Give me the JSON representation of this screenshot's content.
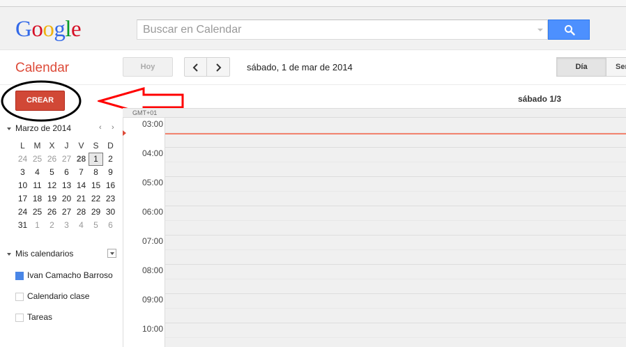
{
  "colors": {
    "accent_red": "#dd4b39",
    "create_button": "#d14836",
    "search_blue": "#4d90fe",
    "calendar_blue": "#4986e7",
    "annotation_red": "#ff0000"
  },
  "header": {
    "logo_letters": [
      "G",
      "o",
      "o",
      "g",
      "l",
      "e"
    ],
    "logo_colors": [
      "#3369e8",
      "#d50f25",
      "#eeb211",
      "#3369e8",
      "#009925",
      "#d50f25"
    ],
    "search_placeholder": "Buscar en Calendar",
    "search_icon": "search-icon"
  },
  "toolbar": {
    "app_title": "Calendar",
    "today_label": "Hoy",
    "prev_icon": "chevron-left-icon",
    "next_icon": "chevron-right-icon",
    "current_date": "sábado, 1 de mar de 2014",
    "view_day_label": "Día",
    "view_week_label": "Semana"
  },
  "sidebar": {
    "create_label": "CREAR",
    "mini_calendar": {
      "title": "Marzo de 2014",
      "prev": "‹",
      "next": "›",
      "weekdays": [
        "L",
        "M",
        "X",
        "J",
        "V",
        "S",
        "D"
      ],
      "weeks": [
        [
          "24",
          "25",
          "26",
          "27",
          "28",
          "1",
          "2"
        ],
        [
          "3",
          "4",
          "5",
          "6",
          "7",
          "8",
          "9"
        ],
        [
          "10",
          "11",
          "12",
          "13",
          "14",
          "15",
          "16"
        ],
        [
          "17",
          "18",
          "19",
          "20",
          "21",
          "22",
          "23"
        ],
        [
          "24",
          "25",
          "26",
          "27",
          "28",
          "29",
          "30"
        ],
        [
          "31",
          "1",
          "2",
          "3",
          "4",
          "5",
          "6"
        ]
      ]
    },
    "my_calendars": {
      "title": "Mis calendarios",
      "items": [
        {
          "label": "Ivan Camacho Barroso",
          "color": "#4986e7",
          "checked": true
        },
        {
          "label": "Calendario clase",
          "color": "",
          "checked": false
        },
        {
          "label": "Tareas",
          "color": "",
          "checked": false
        }
      ]
    }
  },
  "main": {
    "day_header_prefix": "sábado ",
    "day_header_bold": "1/3",
    "timezone": "GMT+01",
    "hours": [
      "03:00",
      "04:00",
      "05:00",
      "06:00",
      "07:00",
      "08:00",
      "09:00",
      "10:00"
    ]
  }
}
